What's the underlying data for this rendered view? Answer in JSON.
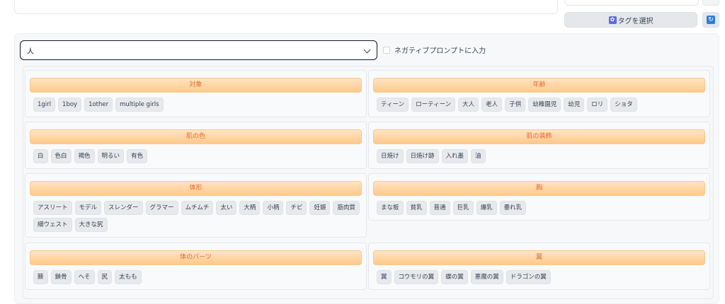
{
  "toolbar": {
    "select_tags_label": "タグを選択",
    "select_tags_icon": "tag-icon",
    "refresh_icon": "refresh-icon"
  },
  "filter": {
    "category_value": "人",
    "negative_checkbox_label": "ネガティブプロンプトに入力",
    "negative_checked": false
  },
  "groups": [
    {
      "title": "対象",
      "tags": [
        "1girl",
        "1boy",
        "1other",
        "multiple girls"
      ]
    },
    {
      "title": "年齢",
      "tags": [
        "ティーン",
        "ローティーン",
        "大人",
        "老人",
        "子供",
        "幼稚園児",
        "幼児",
        "ロリ",
        "ショタ"
      ]
    },
    {
      "title": "肌の色",
      "tags": [
        "白",
        "色白",
        "褐色",
        "明るい",
        "有色"
      ]
    },
    {
      "title": "肌の装飾",
      "tags": [
        "日焼け",
        "日焼け跡",
        "入れ墨",
        "油"
      ]
    },
    {
      "title": "体形",
      "tags": [
        "アスリート",
        "モデル",
        "スレンダー",
        "グラマー",
        "ムチムチ",
        "太い",
        "大柄",
        "小柄",
        "チビ",
        "妊娠",
        "筋肉質",
        "細ウェスト",
        "大きな尻"
      ]
    },
    {
      "title": "胸",
      "tags": [
        "まな板",
        "貧乳",
        "普通",
        "巨乳",
        "爆乳",
        "垂れ乳"
      ]
    },
    {
      "title": "体のパーツ",
      "tags": [
        "腋",
        "鎖骨",
        "へそ",
        "尻",
        "太もも"
      ]
    },
    {
      "title": "翼",
      "tags": [
        "翼",
        "コウモリの翼",
        "蝶の翼",
        "悪魔の翼",
        "ドラゴンの翼"
      ]
    }
  ]
}
